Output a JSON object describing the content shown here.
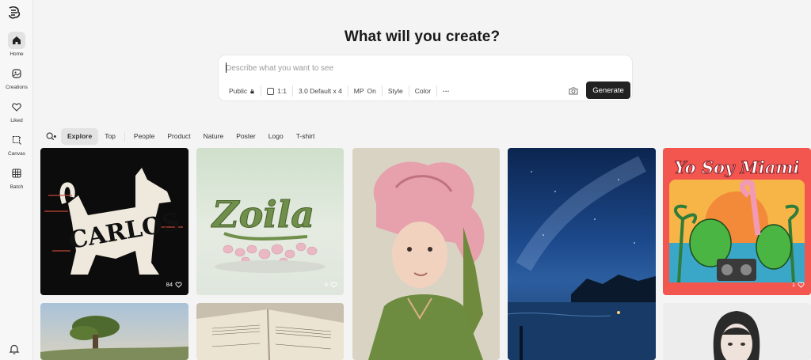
{
  "sidebar": {
    "items": [
      {
        "label": "Home",
        "icon": "home-icon"
      },
      {
        "label": "Creations",
        "icon": "image-icon"
      },
      {
        "label": "Liked",
        "icon": "heart-icon"
      },
      {
        "label": "Canvas",
        "icon": "canvas-icon"
      },
      {
        "label": "Batch",
        "icon": "batch-icon"
      }
    ]
  },
  "header": {
    "title": "What will you create?"
  },
  "prompt": {
    "placeholder": "Describe what you want to see",
    "visibility": "Public",
    "aspect": "1:1",
    "model": "3.0 Default x 4",
    "mp_label": "MP",
    "mp_value": "On",
    "style": "Style",
    "color": "Color",
    "more": "···",
    "generate": "Generate"
  },
  "tabs": [
    "Explore",
    "Top",
    "People",
    "Product",
    "Nature",
    "Poster",
    "Logo",
    "T-shirt"
  ],
  "gallery": [
    {
      "name": "carlos-dog-art",
      "likes": "84"
    },
    {
      "name": "zoila-balloon-art",
      "likes": "6"
    },
    {
      "name": "girl-pink-flower-hat",
      "likes": ""
    },
    {
      "name": "night-sky-lake",
      "likes": ""
    },
    {
      "name": "yo-soy-miami-tshirt",
      "likes": "1",
      "text": "Yo Soy Miami"
    }
  ],
  "colors": {
    "accent": "#222222",
    "background": "#f4f4f4"
  }
}
